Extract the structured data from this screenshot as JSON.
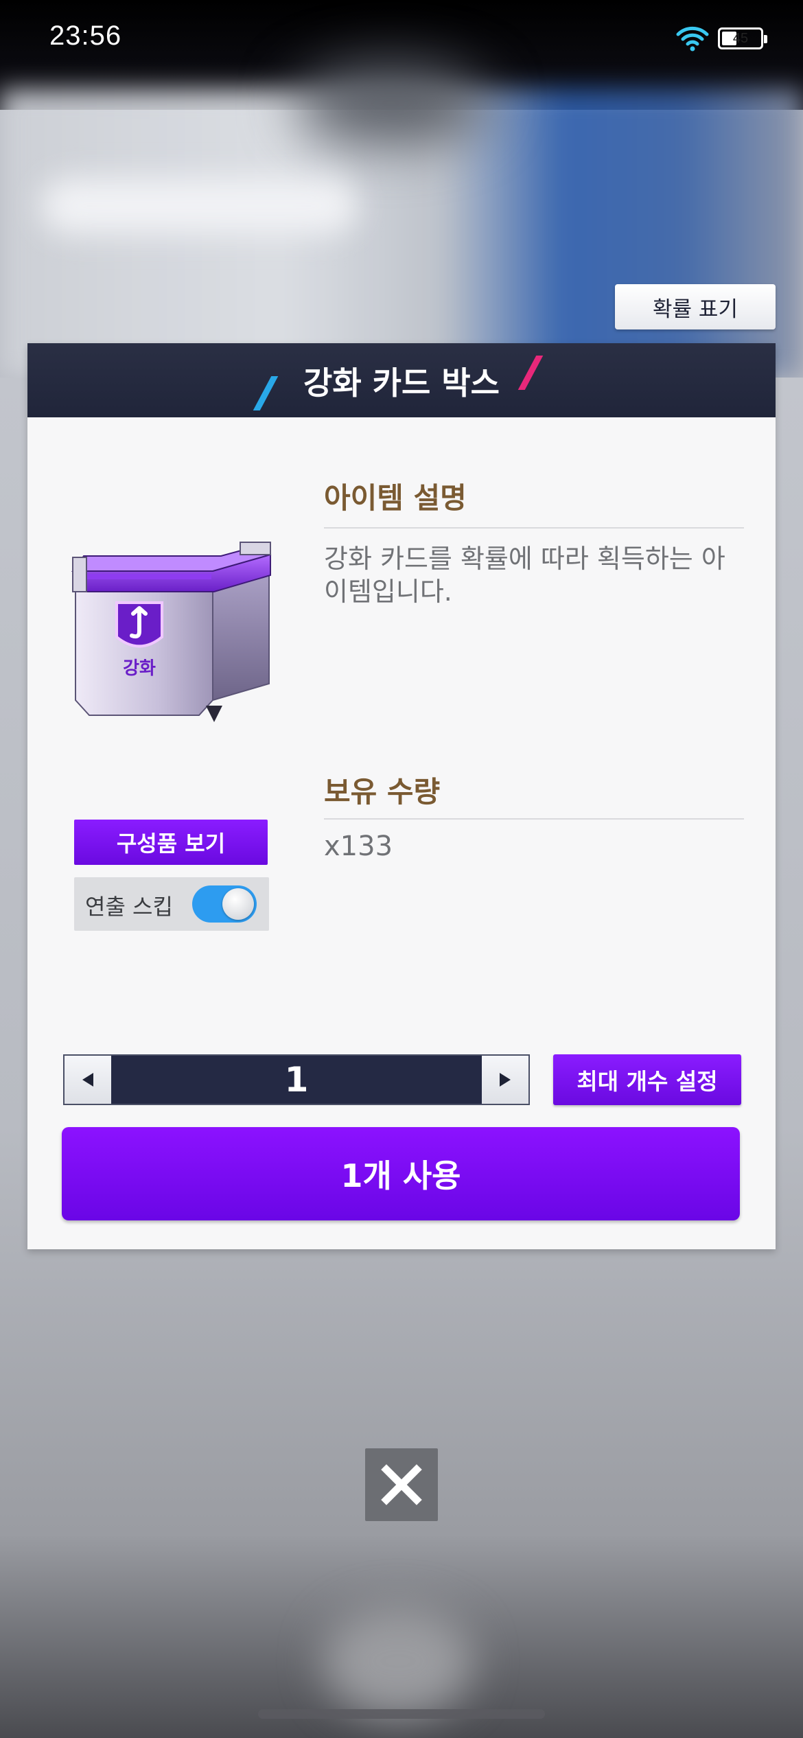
{
  "status_bar": {
    "time": "23:56",
    "battery_level": "45",
    "battery_fraction": 0.45
  },
  "probability_button": {
    "label": "확률 표기"
  },
  "dialog": {
    "title": "강화 카드 박스",
    "item_image_label": "강화",
    "description": {
      "heading": "아이템 설명",
      "text": "강화 카드를 확률에 따라 획득하는 아이템입니다."
    },
    "quantity": {
      "heading": "보유 수량",
      "value": "x133"
    },
    "compose_button": "구성품 보기",
    "skip_effect": {
      "label": "연출 스킵",
      "enabled": true
    },
    "stepper": {
      "value": "1",
      "decrement_icon": "triangle-left-icon",
      "increment_icon": "triangle-right-icon"
    },
    "max_button": "최대 개수 설정",
    "use_button": "1개 사용"
  },
  "close_button": {
    "icon": "close-icon"
  },
  "colors": {
    "accent_purple": "#7a12f5",
    "header_navy": "#252a3f",
    "toggle_blue": "#2d9cf0",
    "heading_brown": "#7a5a32"
  }
}
